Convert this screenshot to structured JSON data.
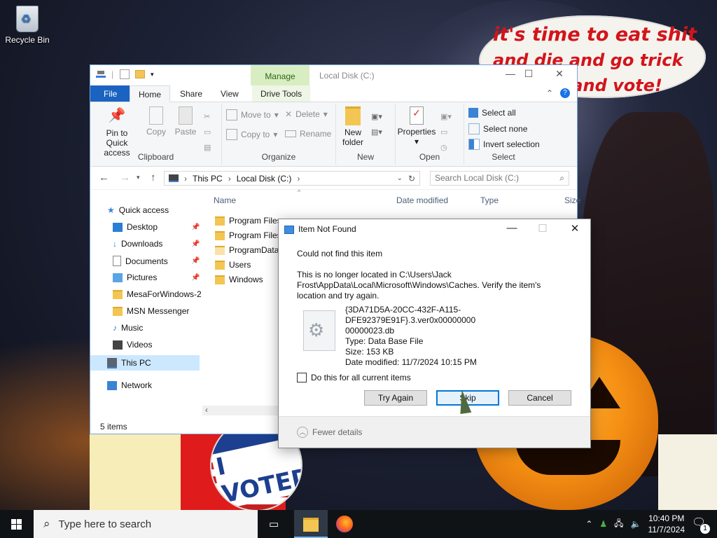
{
  "desktop": {
    "recycle_bin_label": "Recycle Bin",
    "meme_text": [
      "it's time to eat shit",
      "and die and go trick",
      "or treat and vote!"
    ],
    "badge_text": "I VOTED"
  },
  "explorer": {
    "context_tab": "Manage",
    "title": "Local Disk (C:)",
    "tabs": {
      "file": "File",
      "home": "Home",
      "share": "Share",
      "view": "View",
      "drive_tools": "Drive Tools"
    },
    "ribbon": {
      "clipboard": {
        "label": "Clipboard",
        "pin": "Pin to Quick access",
        "copy": "Copy",
        "paste": "Paste"
      },
      "organize": {
        "label": "Organize",
        "move_to": "Move to",
        "copy_to": "Copy to",
        "delete": "Delete",
        "rename": "Rename"
      },
      "new": {
        "label": "New",
        "new_folder": "New folder"
      },
      "open": {
        "label": "Open",
        "properties": "Properties"
      },
      "select": {
        "label": "Select",
        "select_all": "Select all",
        "select_none": "Select none",
        "invert": "Invert selection"
      }
    },
    "address": {
      "this_pc": "This PC",
      "local_disk": "Local Disk (C:)"
    },
    "search_placeholder": "Search Local Disk (C:)",
    "nav": {
      "quick_access": "Quick access",
      "desktop": "Desktop",
      "downloads": "Downloads",
      "documents": "Documents",
      "pictures": "Pictures",
      "mesa": "MesaForWindows-2",
      "msn": "MSN Messenger",
      "music": "Music",
      "videos": "Videos",
      "this_pc": "This PC",
      "network": "Network"
    },
    "columns": {
      "name": "Name",
      "date_modified": "Date modified",
      "type": "Type",
      "size": "Size"
    },
    "files": [
      "Program Files",
      "Program Files",
      "ProgramData",
      "Users",
      "Windows"
    ],
    "status": "5 items"
  },
  "dialog": {
    "title": "Item Not Found",
    "heading": "Could not find this item",
    "message": [
      "This is no longer located in C:\\Users\\Jack",
      "Frost\\AppData\\Local\\Microsoft\\Windows\\Caches. Verify the item's",
      "location and try again."
    ],
    "file_name": [
      "{3DA71D5A-20CC-432F-A115-DFE92379E91F}.3.ver0x00000000",
      "00000023.db"
    ],
    "file_type": "Type: Data Base File",
    "file_size": "Size: 153 KB",
    "file_date": "Date modified: 11/7/2024 10:15 PM",
    "checkbox": "Do this for all current items",
    "buttons": {
      "try_again": "Try Again",
      "skip": "Skip",
      "cancel": "Cancel"
    },
    "fewer_details": "Fewer details"
  },
  "taskbar": {
    "search_placeholder": "Type here to search",
    "time": "10:40 PM",
    "date": "11/7/2024",
    "notification_count": "1"
  }
}
